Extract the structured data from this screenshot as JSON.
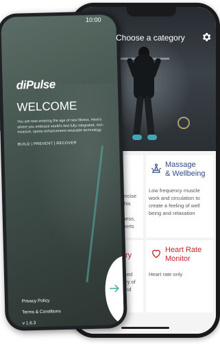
{
  "back_phone": {
    "status_time": "10:00",
    "header_title": "Choose a category",
    "cards": [
      {
        "title_line1": "Massage",
        "title_line2": "& Wellbeing",
        "description": "Low frequency muscle work and circulation to create a feeling of well being and relaxation",
        "icon": "massage-icon",
        "title_color": "#2e4a8c"
      },
      {
        "title_line1": "Heart Rate",
        "title_line2": "Monitor",
        "description": "Heart rate only",
        "icon": "heart-icon",
        "title_color": "#c3242a"
      }
    ],
    "partial_left_text": {
      "line1": "ercise",
      "line2": "this",
      "line3": "ness,",
      "line4": "ports",
      "title_fragment": "ry",
      "line5": "cted",
      "line6": "ery of",
      "line7": "and"
    }
  },
  "front_phone": {
    "logo": "diPulse",
    "welcome_title": "WELCOME",
    "intro_text": "You are now entering the age of new fitness. Here's where you embrace world's first fully integrated, non-invasive, sports enhancement wearable technology.",
    "tags": "BUILD | PREVENT | RECOVER",
    "privacy_link": "Privacy Policy",
    "terms_link": "Terms & Conditions",
    "version": "v 1.6.3",
    "next_icon": "arrow-right-icon",
    "accent_color": "#52b0a5"
  }
}
